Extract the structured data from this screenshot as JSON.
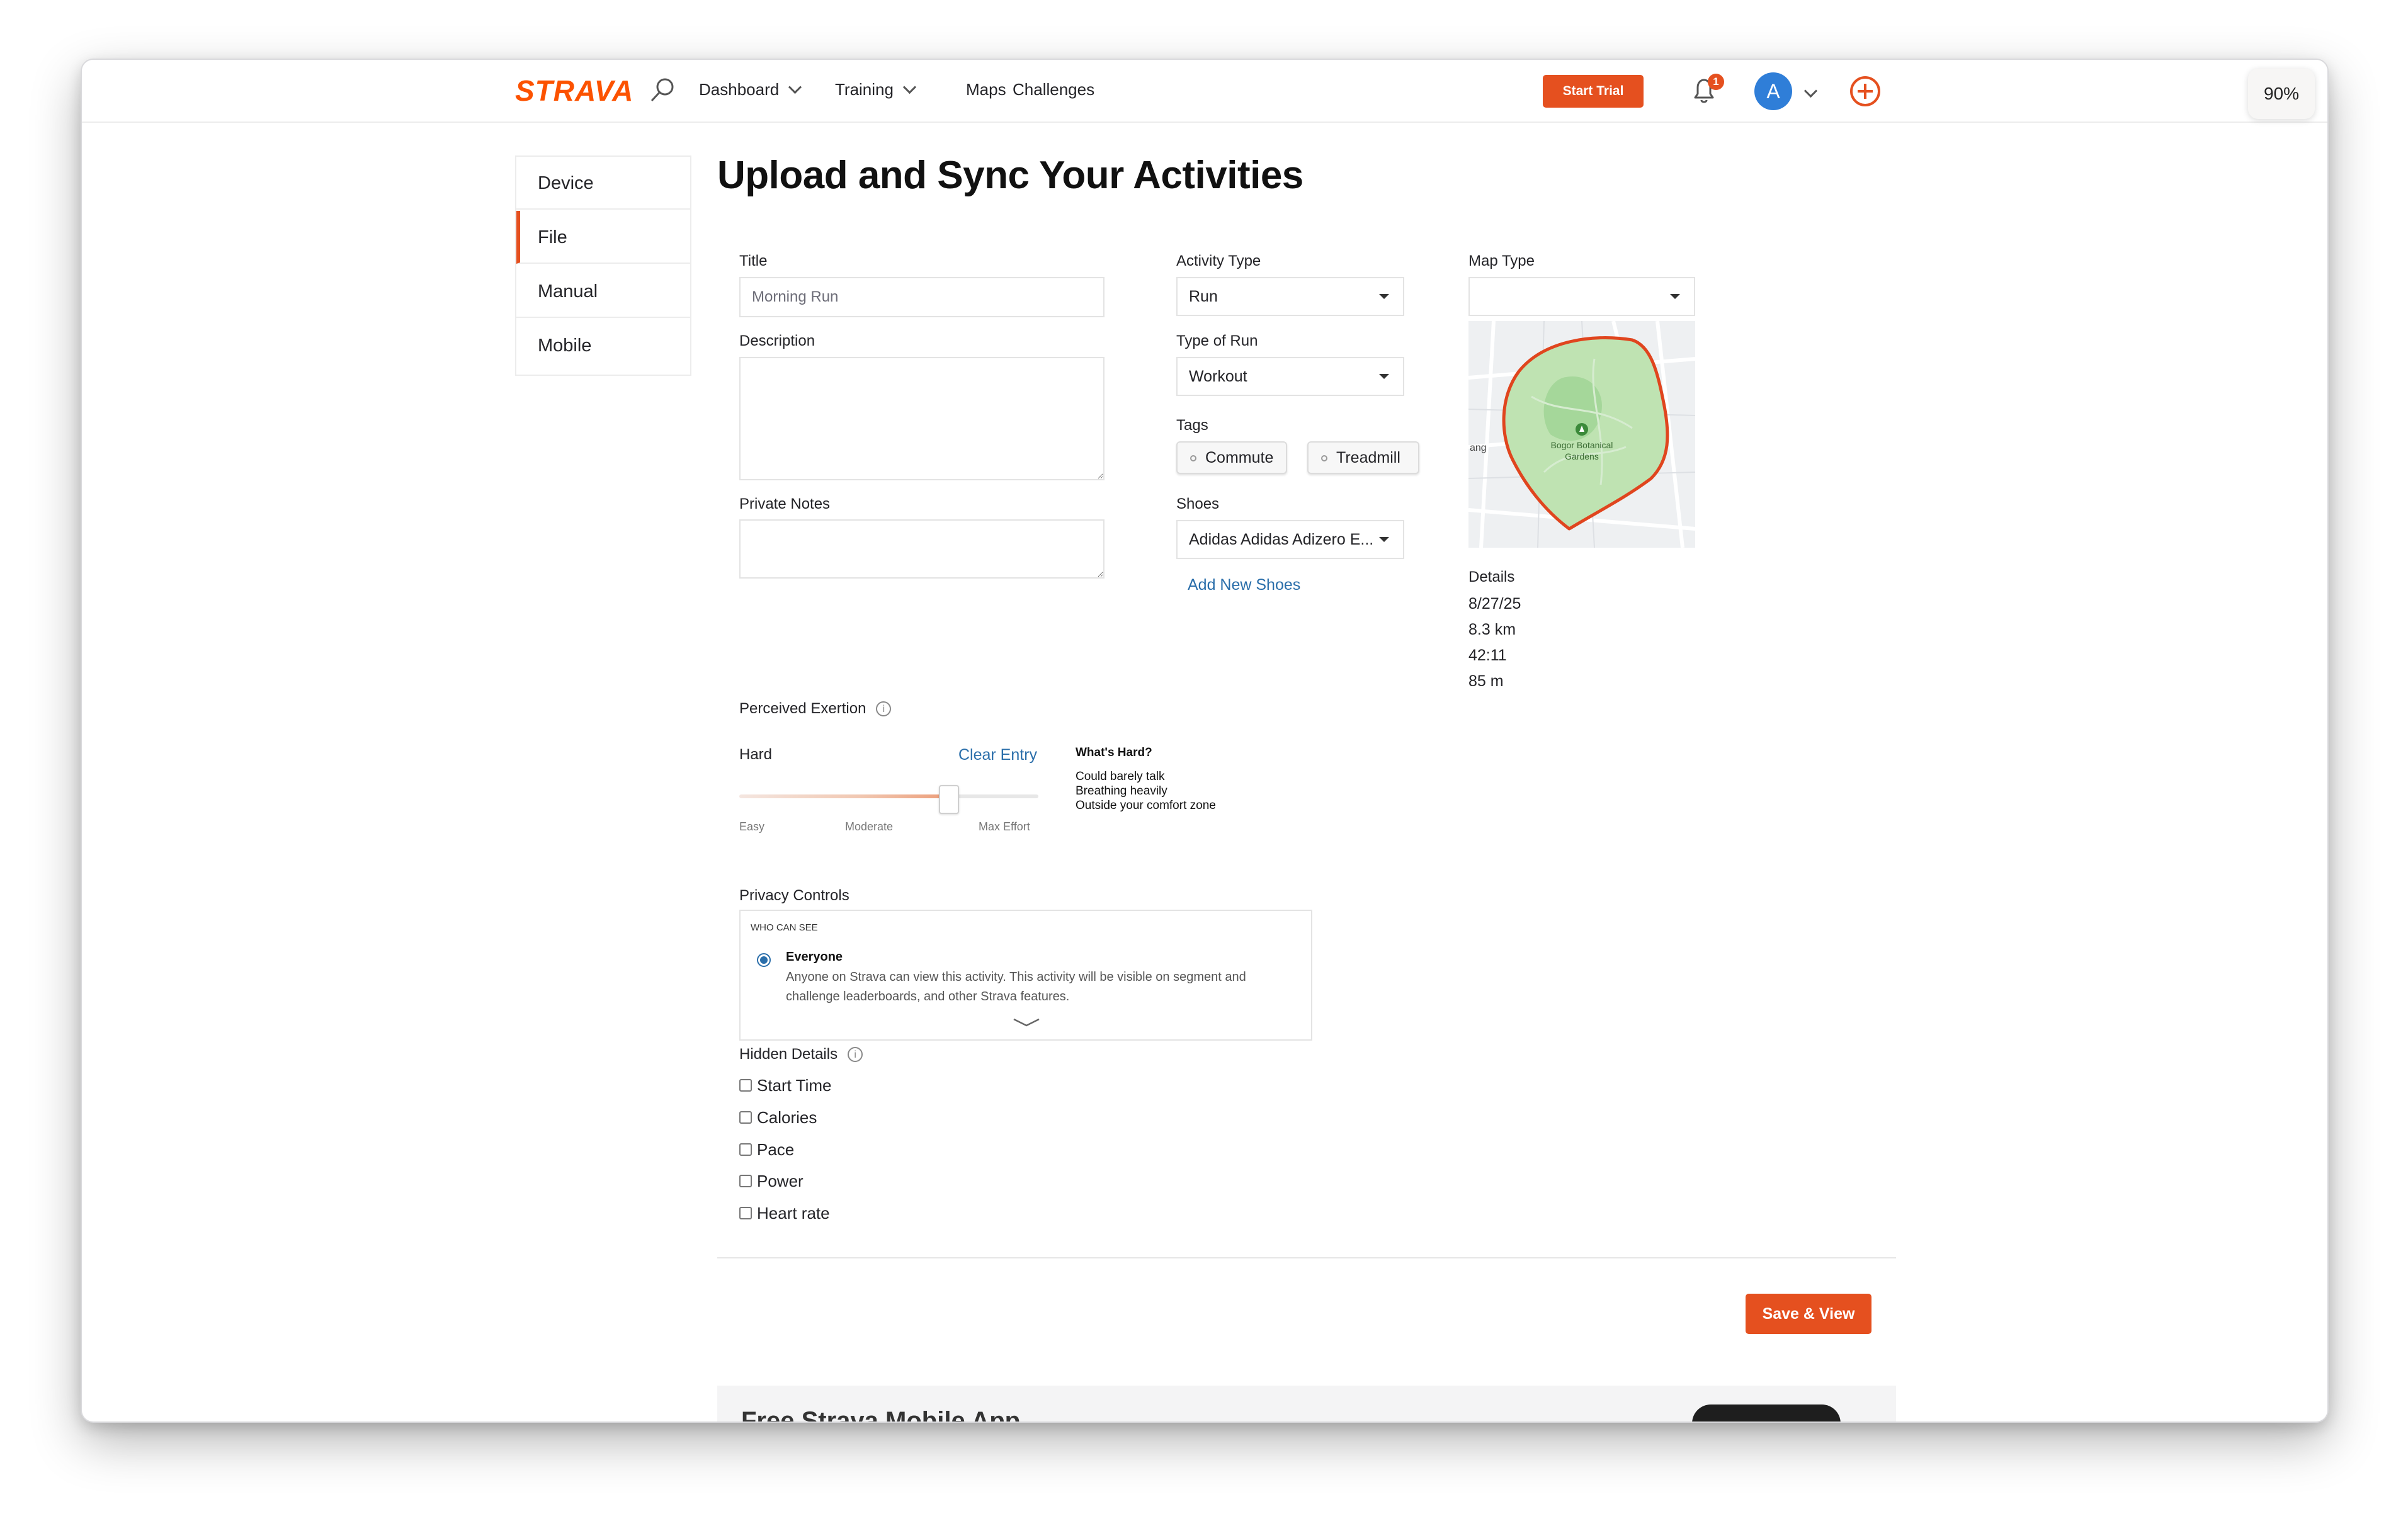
{
  "header": {
    "logo": "STRAVA",
    "nav": {
      "dashboard": "Dashboard",
      "training": "Training",
      "maps": "Maps",
      "challenges": "Challenges"
    },
    "start_trial": "Start Trial",
    "notification_count": "1",
    "avatar_initial": "A",
    "zoom": "90%"
  },
  "sidebar": {
    "items": [
      {
        "label": "Device"
      },
      {
        "label": "File"
      },
      {
        "label": "Manual"
      },
      {
        "label": "Mobile"
      }
    ]
  },
  "page": {
    "title": "Upload and Sync Your Activities"
  },
  "form": {
    "title_label": "Title",
    "title_value": "Morning Run",
    "description_label": "Description",
    "private_notes_label": "Private Notes",
    "activity_type_label": "Activity Type",
    "activity_type_value": "Run",
    "run_type_label": "Type of Run",
    "run_type_value": "Workout",
    "tags_label": "Tags",
    "tags": [
      "Commute",
      "Treadmill"
    ],
    "shoes_label": "Shoes",
    "shoes_value": "Adidas Adidas Adizero E...",
    "add_shoes": "Add New Shoes",
    "map_type_label": "Map Type",
    "map_type_value": "",
    "map_place_label": "Bogor Botanical Gardens",
    "map_edge_label": "ang",
    "details_label": "Details",
    "details": [
      "8/27/25",
      "8.3 km",
      "42:11",
      "85 m"
    ]
  },
  "exertion": {
    "label": "Perceived Exertion",
    "value_label": "Hard",
    "clear": "Clear Entry",
    "level": 0.7,
    "scale": [
      "Easy",
      "Moderate",
      "Max Effort"
    ],
    "hint_title": "What's Hard?",
    "hint_lines": [
      "Could barely talk",
      "Breathing heavily",
      "Outside your comfort zone"
    ]
  },
  "privacy": {
    "label": "Privacy Controls",
    "who_can_see": "WHO CAN SEE",
    "option": "Everyone",
    "option_desc_1": "Anyone on Strava can view this activity. This activity will be visible on segment and",
    "option_desc_2": "challenge leaderboards, and other Strava features."
  },
  "hidden_details": {
    "label": "Hidden Details",
    "items": [
      "Start Time",
      "Calories",
      "Pace",
      "Power",
      "Heart rate"
    ]
  },
  "save_button": "Save & View",
  "promo_title": "Free Strava Mobile App",
  "colors": {
    "brand": "#fc5200",
    "button": "#e5501f",
    "link": "#2a6eaa",
    "map_route": "#e0451e"
  }
}
